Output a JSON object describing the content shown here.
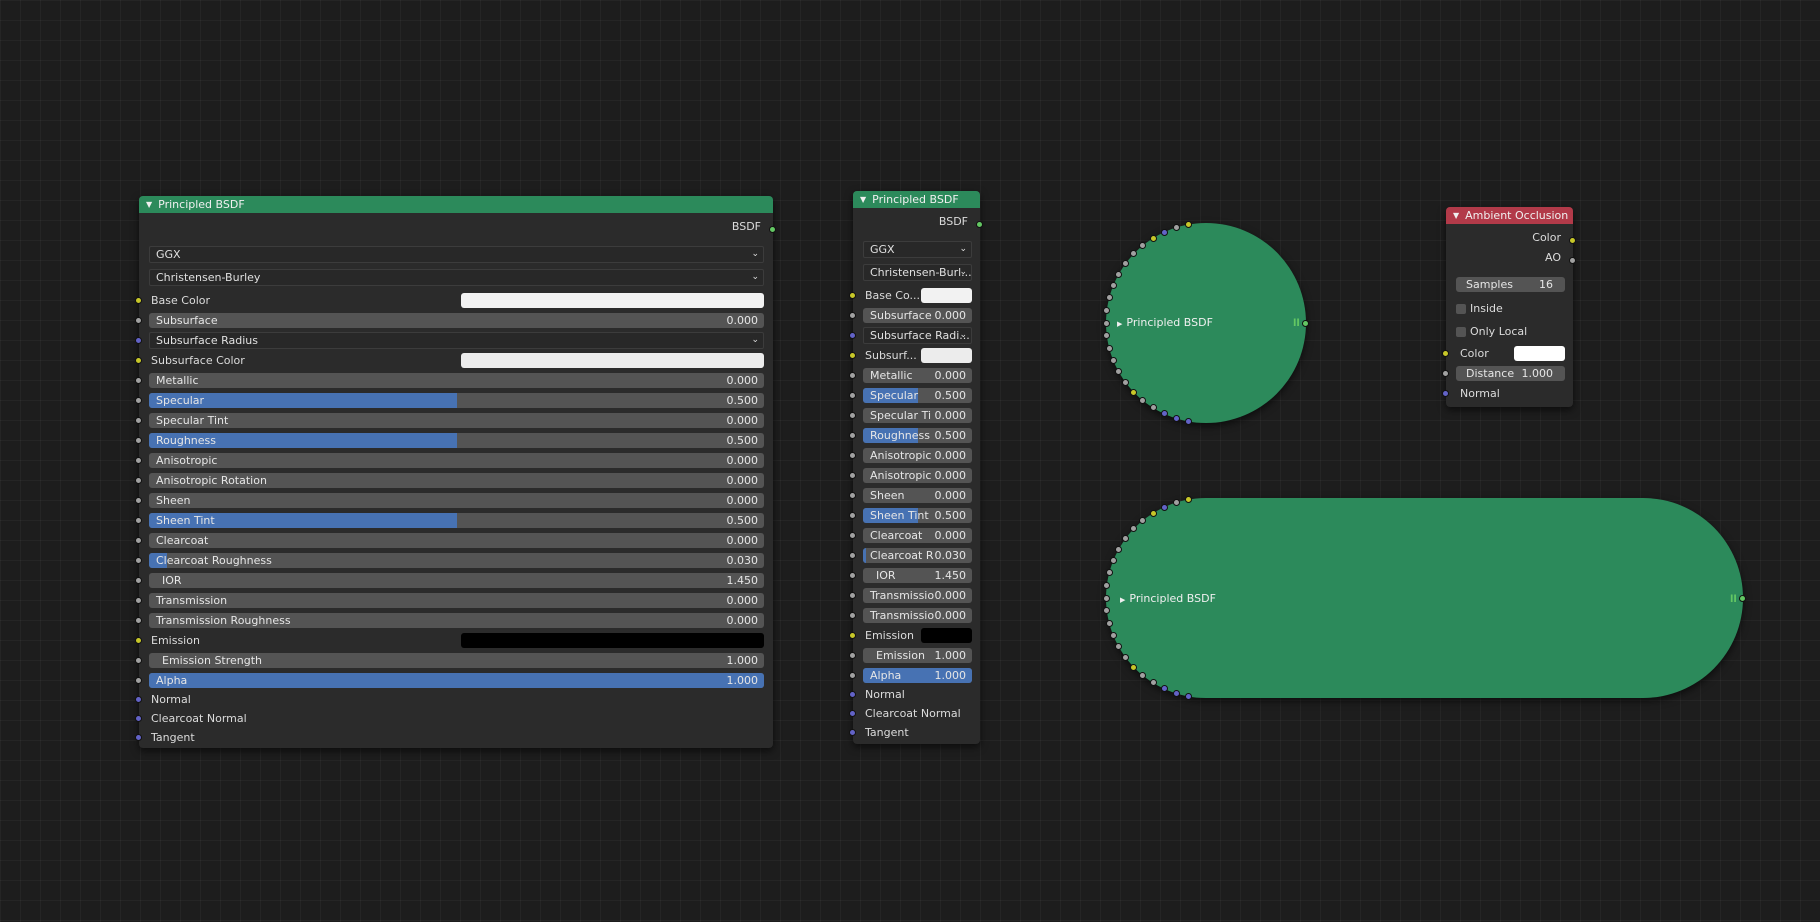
{
  "large_node": {
    "title": "Principled BSDF",
    "output": "BSDF",
    "distribution": "GGX",
    "subsurface_method": "Christensen-Burley",
    "base_color_label": "Base Color",
    "subsurface_label": "Subsurface",
    "subsurface_value": "0.000",
    "subsurface_radius_label": "Subsurface Radius",
    "subsurface_color_label": "Subsurface Color",
    "metallic_label": "Metallic",
    "metallic_value": "0.000",
    "specular_label": "Specular",
    "specular_value": "0.500",
    "specular_tint_label": "Specular Tint",
    "specular_tint_value": "0.000",
    "roughness_label": "Roughness",
    "roughness_value": "0.500",
    "anisotropic_label": "Anisotropic",
    "anisotropic_value": "0.000",
    "anisotropic_rotation_label": "Anisotropic Rotation",
    "anisotropic_rotation_value": "0.000",
    "sheen_label": "Sheen",
    "sheen_value": "0.000",
    "sheen_tint_label": "Sheen Tint",
    "sheen_tint_value": "0.500",
    "clearcoat_label": "Clearcoat",
    "clearcoat_value": "0.000",
    "clearcoat_roughness_label": "Clearcoat Roughness",
    "clearcoat_roughness_value": "0.030",
    "ior_label": "IOR",
    "ior_value": "1.450",
    "transmission_label": "Transmission",
    "transmission_value": "0.000",
    "transmission_roughness_label": "Transmission Roughness",
    "transmission_roughness_value": "0.000",
    "emission_label": "Emission",
    "emission_strength_label": "Emission Strength",
    "emission_strength_value": "1.000",
    "alpha_label": "Alpha",
    "alpha_value": "1.000",
    "normal_label": "Normal",
    "clearcoat_normal_label": "Clearcoat Normal",
    "tangent_label": "Tangent"
  },
  "small_node": {
    "title": "Principled BSDF",
    "output": "BSDF",
    "distribution": "GGX",
    "subsurface_method": "Christensen-Burl...",
    "base_color_label": "Base Co...",
    "subsurface_label": "Subsurface",
    "subsurface_value": "0.000",
    "subsurface_radius_label": "Subsurface Radi...",
    "subsurface_color_label": "Subsurf...",
    "metallic_label": "Metallic",
    "metallic_value": "0.000",
    "specular_label": "Specular",
    "specular_value": "0.500",
    "specular_tint_label": "Specular Ti",
    "specular_tint_value": "0.000",
    "roughness_label": "Roughness",
    "roughness_value": "0.500",
    "anisotropic_label": "Anisotropic",
    "anisotropic_value": "0.000",
    "anisotropic_rotation_label": "Anisotropic",
    "anisotropic_rotation_value": "0.000",
    "sheen_label": "Sheen",
    "sheen_value": "0.000",
    "sheen_tint_label": "Sheen Tint",
    "sheen_tint_value": "0.500",
    "clearcoat_label": "Clearcoat",
    "clearcoat_value": "0.000",
    "clearcoat_roughness_label": "Clearcoat R",
    "clearcoat_roughness_value": "0.030",
    "ior_label": "IOR",
    "ior_value": "1.450",
    "transmission_label": "Transmissio",
    "transmission_value": "0.000",
    "transmission_roughness_label": "Transmissio",
    "transmission_roughness_value": "0.000",
    "emission_label": "Emission",
    "emission_strength_label": "Emission",
    "emission_strength_value": "1.000",
    "alpha_label": "Alpha",
    "alpha_value": "1.000",
    "normal_label": "Normal",
    "clearcoat_normal_label": "Clearcoat Normal",
    "tangent_label": "Tangent"
  },
  "circle_node": {
    "title": "Principled BSDF"
  },
  "pill_node": {
    "title": "Principled BSDF"
  },
  "ao_node": {
    "title": "Ambient Occlusion",
    "output_color": "Color",
    "output_ao": "AO",
    "samples_label": "Samples",
    "samples_value": "16",
    "inside_label": "Inside",
    "only_local_label": "Only Local",
    "color_label": "Color",
    "distance_label": "Distance",
    "distance_value": "1.000",
    "normal_label": "Normal"
  },
  "colors": {
    "header_green": "#2c8a5b",
    "header_red": "#b23a49",
    "slider_fill": "#4772b3",
    "socket_yellow": "#c7c729",
    "socket_gray": "#a1a1a1",
    "socket_purple": "#6363c7",
    "socket_green": "#63c763"
  }
}
